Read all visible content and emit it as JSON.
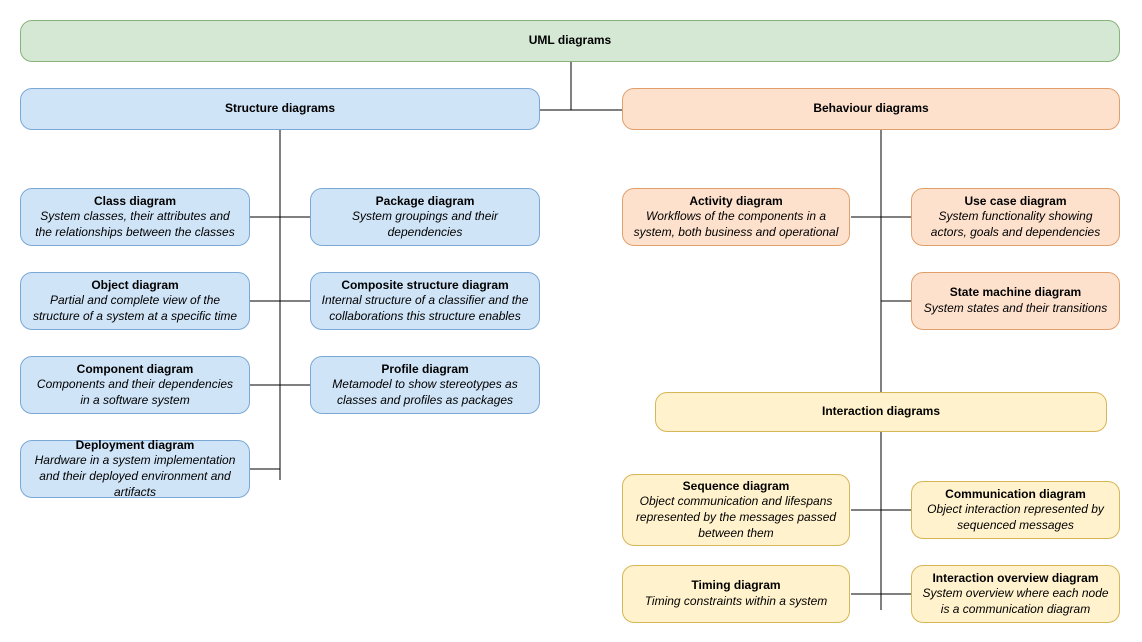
{
  "root": {
    "title": "UML diagrams"
  },
  "structure": {
    "title": "Structure diagrams"
  },
  "behaviour": {
    "title": "Behaviour diagrams"
  },
  "interaction": {
    "title": "Interaction diagrams"
  },
  "class": {
    "title": "Class diagram",
    "desc": "System classes, their attributes and  the relationships between the classes"
  },
  "object": {
    "title": "Object diagram",
    "desc": "Partial and complete view of the structure of a system at a specific time"
  },
  "component": {
    "title": "Component diagram",
    "desc": "Components and their dependencies in a software system"
  },
  "deployment": {
    "title": "Deployment diagram",
    "desc": "Hardware in a system implementation and their deployed environment and artifacts"
  },
  "package": {
    "title": "Package diagram",
    "desc": "System groupings and their dependencies"
  },
  "composite": {
    "title": "Composite structure diagram",
    "desc": "Internal structure of a classifier and the collaborations this structure enables"
  },
  "profile": {
    "title": "Profile diagram",
    "desc": "Metamodel to show stereotypes as classes and profiles as packages"
  },
  "activity": {
    "title": "Activity diagram",
    "desc": "Workflows of the components in a system, both business and operational"
  },
  "usecase": {
    "title": "Use case diagram",
    "desc": "System functionality showing actors, goals and dependencies"
  },
  "statemachine": {
    "title": "State machine diagram",
    "desc": "System states and their transitions"
  },
  "sequence": {
    "title": "Sequence diagram",
    "desc": "Object communication and lifespans represented by the messages passed between them"
  },
  "communication": {
    "title": "Communication diagram",
    "desc": "Object interaction represented by sequenced messages"
  },
  "timing": {
    "title": "Timing diagram",
    "desc": "Timing constraints within a system"
  },
  "overview": {
    "title": "Interaction overview diagram",
    "desc": "System overview where each node is a communication diagram"
  }
}
